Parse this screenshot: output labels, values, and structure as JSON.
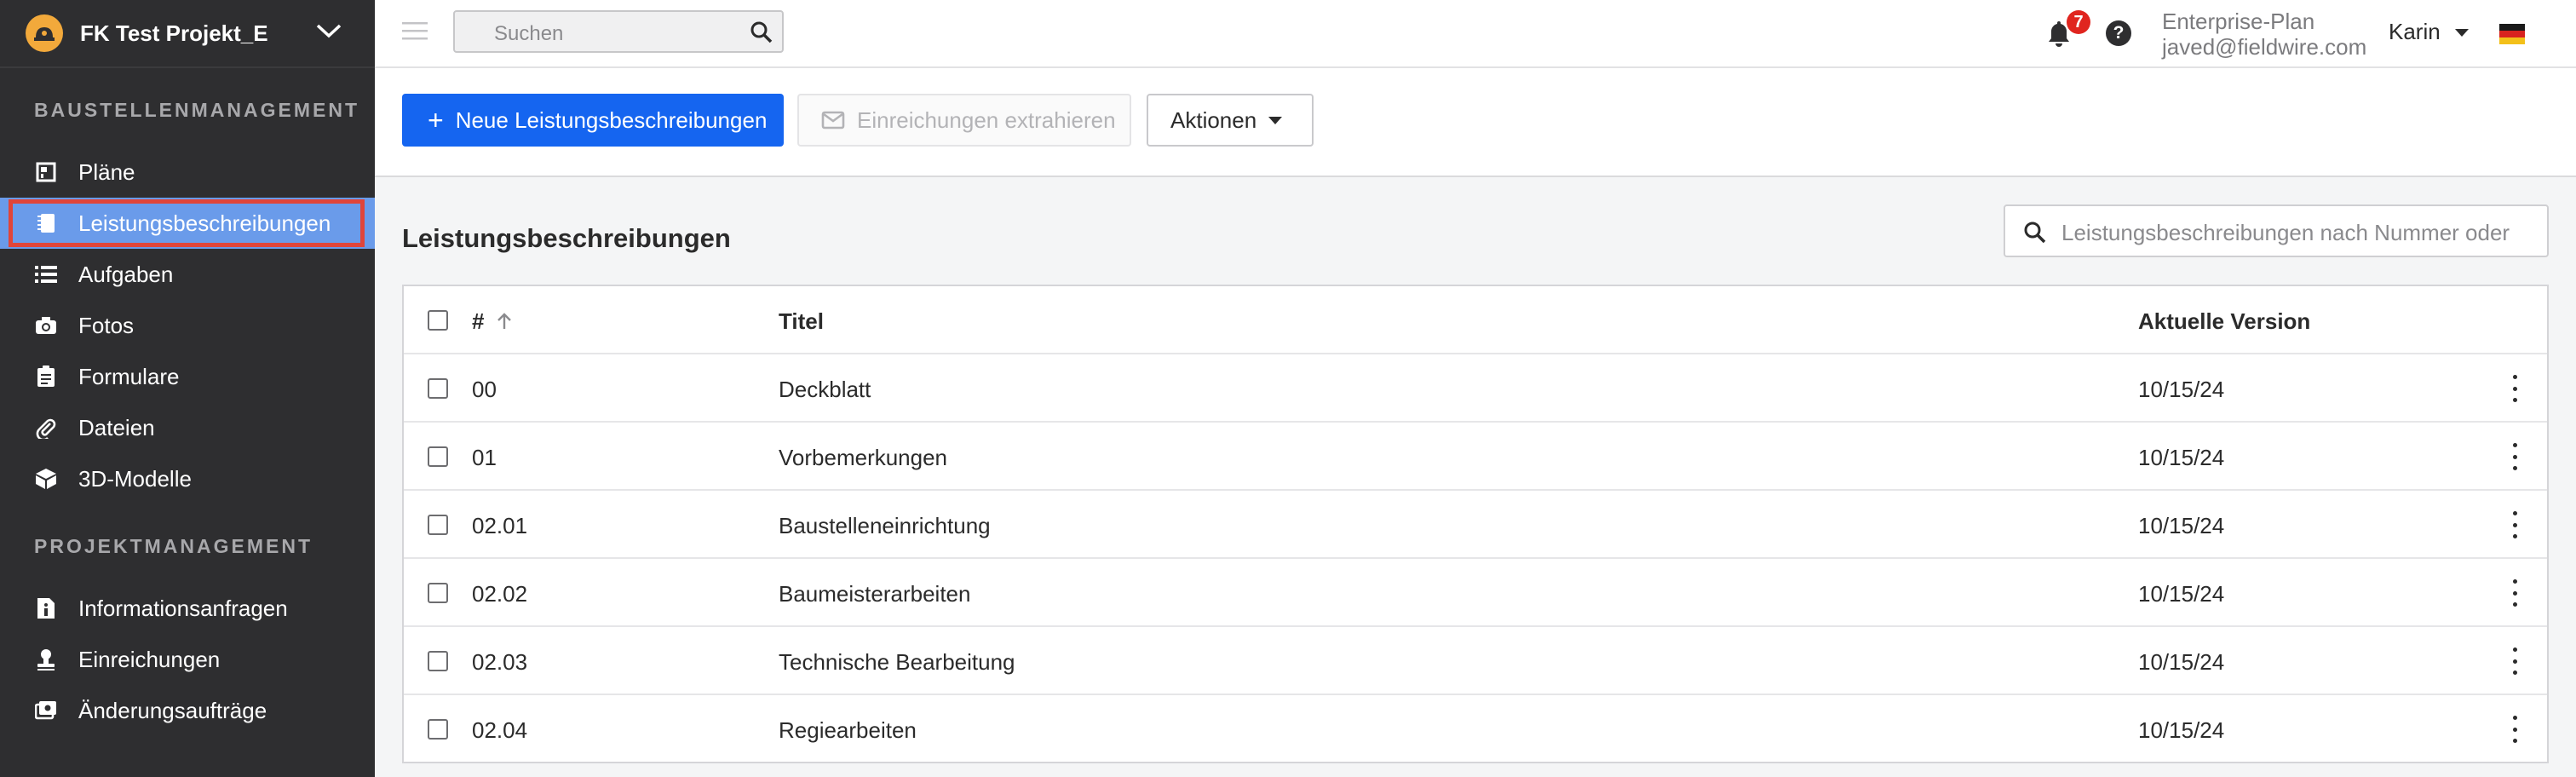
{
  "project": {
    "name": "FK Test Projekt_E",
    "logo_icon": "hardhat-icon",
    "accent": "#f2a93b"
  },
  "sidebar": {
    "sections": [
      {
        "title": "BAUSTELLENMANAGEMENT",
        "items": [
          {
            "label": "Pläne",
            "icon": "plans-icon"
          },
          {
            "label": "Leistungsbeschreibungen",
            "icon": "specifications-icon",
            "active": true
          },
          {
            "label": "Aufgaben",
            "icon": "list-icon"
          },
          {
            "label": "Fotos",
            "icon": "camera-icon"
          },
          {
            "label": "Formulare",
            "icon": "clipboard-icon"
          },
          {
            "label": "Dateien",
            "icon": "paperclip-icon"
          },
          {
            "label": "3D-Modelle",
            "icon": "cube-icon"
          }
        ]
      },
      {
        "title": "PROJEKTMANAGEMENT",
        "items": [
          {
            "label": "Informationsanfragen",
            "icon": "info-document-icon"
          },
          {
            "label": "Einreichungen",
            "icon": "stamp-icon"
          },
          {
            "label": "Änderungsaufträge",
            "icon": "change-order-icon"
          }
        ]
      }
    ],
    "active_color": "#6a9bea",
    "highlight_border": "#e0453a"
  },
  "topbar": {
    "search_placeholder": "Suchen",
    "notification_count": "7",
    "help_label": "?",
    "plan": "Enterprise-Plan",
    "email": "javed@fieldwire.com",
    "user": "Karin",
    "language_flag": "germany-flag-icon"
  },
  "toolbar": {
    "new_label": "Neue Leistungsbeschreibungen",
    "extract_label": "Einreichungen extrahieren",
    "actions_label": "Aktionen",
    "primary_color": "#1565f0"
  },
  "main": {
    "title": "Leistungsbeschreibungen",
    "filter_placeholder": "Leistungsbeschreibungen nach Nummer oder"
  },
  "table": {
    "columns": {
      "number": "#",
      "title": "Titel",
      "version": "Aktuelle Version"
    },
    "rows": [
      {
        "number": "00",
        "title": "Deckblatt",
        "version": "10/15/24"
      },
      {
        "number": "01",
        "title": "Vorbemerkungen",
        "version": "10/15/24"
      },
      {
        "number": "02.01",
        "title": "Baustelleneinrichtung",
        "version": "10/15/24"
      },
      {
        "number": "02.02",
        "title": "Baumeisterarbeiten",
        "version": "10/15/24"
      },
      {
        "number": "02.03",
        "title": "Technische Bearbeitung",
        "version": "10/15/24"
      },
      {
        "number": "02.04",
        "title": "Regiearbeiten",
        "version": "10/15/24"
      }
    ]
  }
}
